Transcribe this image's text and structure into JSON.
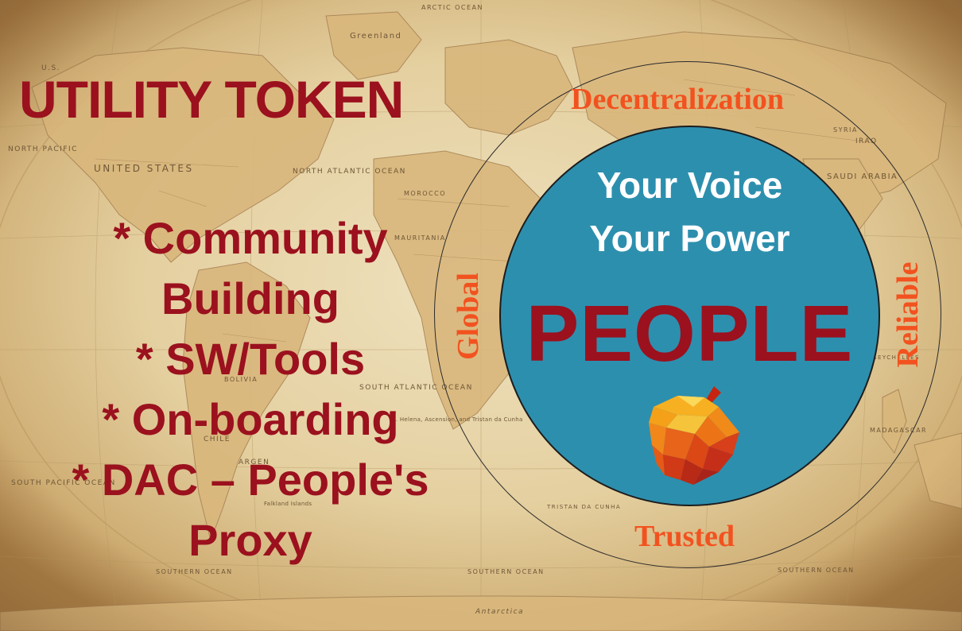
{
  "headline": "UTILITY TOKEN",
  "bullets": [
    "* Community",
    "Building",
    "* SW/Tools",
    "* On-boarding",
    "* DAC – People's",
    "Proxy"
  ],
  "center": {
    "tagline_line1": "Your Voice",
    "tagline_line2": "Your Power",
    "main_word": "PEOPLE"
  },
  "ring_words": {
    "top": "Decentralization",
    "right": "Reliable",
    "bottom": "Trusted",
    "left": "Global"
  },
  "map_labels": {
    "greenland": "Greenland",
    "us_short": "U.S.",
    "united_states": "UNITED STATES",
    "north_pacific": "NORTH PACIFIC",
    "north_atlantic": "NORTH ATLANTIC OCEAN",
    "south_atlantic": "SOUTH ATLANTIC OCEAN",
    "south_pacific": "SOUTH PACIFIC OCEAN",
    "saudi_arabia": "SAUDI ARABIA",
    "iraq": "IRAQ",
    "syria": "SYRIA",
    "morocco": "MOROCCO",
    "mauritania": "MAURITANIA",
    "bolivia": "BOLIVIA",
    "chile": "CHILE",
    "argentina": "ARGEN",
    "antarctica": "Antarctica",
    "southern_ocean_1": "SOUTHERN OCEAN",
    "southern_ocean_2": "SOUTHERN OCEAN",
    "southern_ocean_3": "SOUTHERN OCEAN",
    "st_helena": "St. Helena, Ascension, and Tristan da Cunha",
    "tristan": "TRISTAN DA CUNHA",
    "madagascar": "MADAGASCAR",
    "seychelles": "SEYCHELLES",
    "falkland": "Falkland Islands",
    "arctic": "ARCTIC OCEAN"
  },
  "colors": {
    "headline_red": "#9b111e",
    "disc_blue": "#2d8fae",
    "ring_word_orange": "#f2521f",
    "parchment": "#e6d3a8"
  },
  "icons": {
    "logo": "acorn-crystal-logo"
  }
}
